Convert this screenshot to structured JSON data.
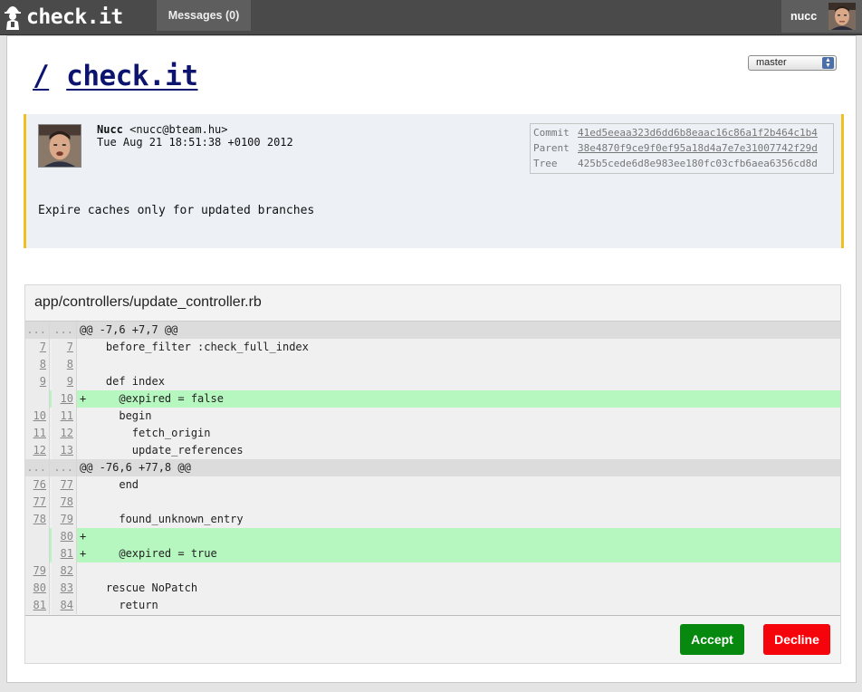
{
  "header": {
    "logo_text": "check.it",
    "messages_label": "Messages (0)",
    "user_name": "nucc",
    "icons": {
      "logo": "detective-logo-icon",
      "user": "user-avatar"
    }
  },
  "repo": {
    "title_separator": "/",
    "title": "check.it",
    "branch": "master"
  },
  "commit": {
    "author_name": "Nucc",
    "author_email": "<nucc@bteam.hu>",
    "date": "Tue Aug 21 18:51:38 +0100 2012",
    "hashes": [
      {
        "label": "Commit",
        "value": "41ed5eeaa323d6dd6b8eaac16c86a1f2b464c1b4"
      },
      {
        "label": "Parent",
        "value": "38e4870f9ce9f0ef95a18d4a7e7e31007742f29d"
      },
      {
        "label": "Tree",
        "value": "425b5cede6d8e983ee180fc03cfb6aea6356cd8d"
      }
    ],
    "message": "Expire caches only for updated branches",
    "accent_color": "#f0c020"
  },
  "diff": {
    "file": "app/controllers/update_controller.rb",
    "lines": [
      {
        "type": "hunk",
        "old": "...",
        "new": "...",
        "code": "@@ -7,6 +7,7 @@"
      },
      {
        "type": "ctx",
        "old": "7",
        "new": "7",
        "code": "    before_filter :check_full_index"
      },
      {
        "type": "ctx",
        "old": "8",
        "new": "8",
        "code": ""
      },
      {
        "type": "ctx",
        "old": "9",
        "new": "9",
        "code": "    def index"
      },
      {
        "type": "add",
        "old": "",
        "new": "10",
        "code": "+     @expired = false"
      },
      {
        "type": "ctx",
        "old": "10",
        "new": "11",
        "code": "      begin"
      },
      {
        "type": "ctx",
        "old": "11",
        "new": "12",
        "code": "        fetch_origin"
      },
      {
        "type": "ctx",
        "old": "12",
        "new": "13",
        "code": "        update_references"
      },
      {
        "type": "hunk",
        "old": "...",
        "new": "...",
        "code": "@@ -76,6 +77,8 @@"
      },
      {
        "type": "ctx",
        "old": "76",
        "new": "77",
        "code": "      end"
      },
      {
        "type": "ctx",
        "old": "77",
        "new": "78",
        "code": ""
      },
      {
        "type": "ctx",
        "old": "78",
        "new": "79",
        "code": "      found_unknown_entry"
      },
      {
        "type": "add",
        "old": "",
        "new": "80",
        "code": "+"
      },
      {
        "type": "add",
        "old": "",
        "new": "81",
        "code": "+     @expired = true"
      },
      {
        "type": "ctx",
        "old": "79",
        "new": "82",
        "code": ""
      },
      {
        "type": "ctx",
        "old": "80",
        "new": "83",
        "code": "    rescue NoPatch"
      },
      {
        "type": "ctx",
        "old": "81",
        "new": "84",
        "code": "      return"
      }
    ],
    "added_color": "#b6f7bf"
  },
  "actions": {
    "accept_label": "Accept",
    "decline_label": "Decline",
    "accept_color": "#07880f",
    "decline_color": "#f5040b"
  }
}
